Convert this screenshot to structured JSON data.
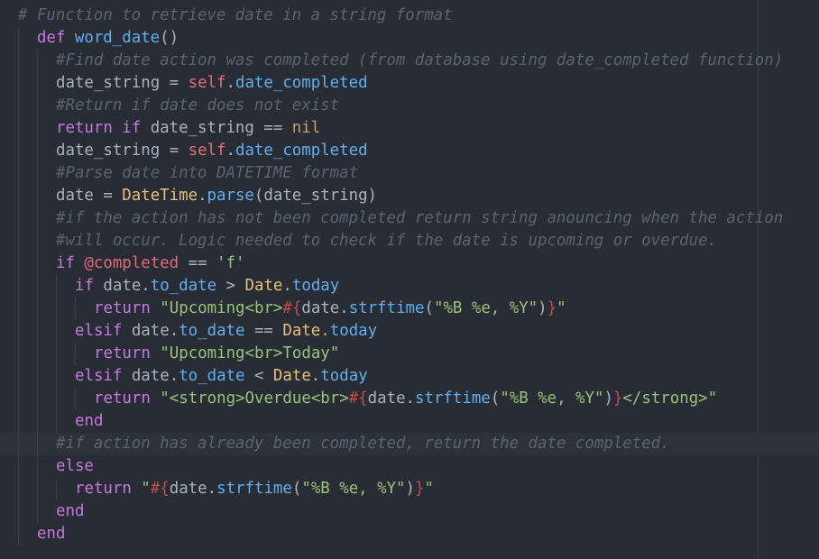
{
  "editor": {
    "theme": {
      "background": "#282c34",
      "cursor_line": "#2c313a",
      "comment": "#5c6370",
      "keyword": "#c678dd",
      "function": "#61afef",
      "self": "#e06c75",
      "constant": "#e5c07b",
      "nil": "#d19a66",
      "string": "#98c379",
      "interpolation": "#be5046",
      "text": "#abb2bf"
    },
    "lines": [
      {
        "indent": 0,
        "tokens": [
          {
            "t": "comment",
            "v": "# Function to retrieve date in a string format"
          }
        ]
      },
      {
        "indent": 1,
        "tokens": [
          {
            "t": "keyword",
            "v": "def "
          },
          {
            "t": "func",
            "v": "word_date"
          },
          {
            "t": "plain",
            "v": "()"
          }
        ]
      },
      {
        "indent": 2,
        "tokens": [
          {
            "t": "comment",
            "v": "#Find date action was completed (from database using date_completed function)"
          }
        ]
      },
      {
        "indent": 2,
        "tokens": [
          {
            "t": "plain",
            "v": "date_string = "
          },
          {
            "t": "self",
            "v": "self"
          },
          {
            "t": "plain",
            "v": "."
          },
          {
            "t": "func",
            "v": "date_completed"
          }
        ]
      },
      {
        "indent": 2,
        "tokens": [
          {
            "t": "comment",
            "v": "#Return if date does not exist"
          }
        ]
      },
      {
        "indent": 2,
        "tokens": [
          {
            "t": "keyword",
            "v": "return if "
          },
          {
            "t": "plain",
            "v": "date_string == "
          },
          {
            "t": "nil",
            "v": "nil"
          }
        ]
      },
      {
        "indent": 2,
        "tokens": [
          {
            "t": "plain",
            "v": "date_string = "
          },
          {
            "t": "self",
            "v": "self"
          },
          {
            "t": "plain",
            "v": "."
          },
          {
            "t": "func",
            "v": "date_completed"
          }
        ]
      },
      {
        "indent": 2,
        "tokens": [
          {
            "t": "comment",
            "v": "#Parse date into DATETIME format"
          }
        ]
      },
      {
        "indent": 2,
        "tokens": [
          {
            "t": "plain",
            "v": "date = "
          },
          {
            "t": "const",
            "v": "DateTime"
          },
          {
            "t": "plain",
            "v": "."
          },
          {
            "t": "func",
            "v": "parse"
          },
          {
            "t": "plain",
            "v": "(date_string)"
          }
        ]
      },
      {
        "indent": 2,
        "tokens": [
          {
            "t": "comment",
            "v": "#if the action has not been completed return string anouncing when the action"
          }
        ]
      },
      {
        "indent": 2,
        "tokens": [
          {
            "t": "comment",
            "v": "#will occur. Logic needed to check if the date is upcoming or overdue."
          }
        ]
      },
      {
        "indent": 2,
        "tokens": [
          {
            "t": "keyword",
            "v": "if "
          },
          {
            "t": "ivar",
            "v": "@completed"
          },
          {
            "t": "plain",
            "v": " == "
          },
          {
            "t": "string",
            "v": "'f'"
          }
        ]
      },
      {
        "indent": 3,
        "tokens": [
          {
            "t": "keyword",
            "v": "if "
          },
          {
            "t": "plain",
            "v": "date."
          },
          {
            "t": "func",
            "v": "to_date"
          },
          {
            "t": "plain",
            "v": " > "
          },
          {
            "t": "const",
            "v": "Date"
          },
          {
            "t": "plain",
            "v": "."
          },
          {
            "t": "func",
            "v": "today"
          }
        ]
      },
      {
        "indent": 4,
        "tokens": [
          {
            "t": "keyword",
            "v": "return "
          },
          {
            "t": "string",
            "v": "\"Upcoming<br>"
          },
          {
            "t": "interp",
            "v": "#{"
          },
          {
            "t": "plain",
            "v": "date."
          },
          {
            "t": "func",
            "v": "strftime"
          },
          {
            "t": "plain",
            "v": "("
          },
          {
            "t": "string",
            "v": "\"%B %e, %Y\""
          },
          {
            "t": "plain",
            "v": ")"
          },
          {
            "t": "interp",
            "v": "}"
          },
          {
            "t": "string",
            "v": "\""
          }
        ]
      },
      {
        "indent": 3,
        "tokens": [
          {
            "t": "keyword",
            "v": "elsif "
          },
          {
            "t": "plain",
            "v": "date."
          },
          {
            "t": "func",
            "v": "to_date"
          },
          {
            "t": "plain",
            "v": " == "
          },
          {
            "t": "const",
            "v": "Date"
          },
          {
            "t": "plain",
            "v": "."
          },
          {
            "t": "func",
            "v": "today"
          }
        ]
      },
      {
        "indent": 4,
        "tokens": [
          {
            "t": "keyword",
            "v": "return "
          },
          {
            "t": "string",
            "v": "\"Upcoming<br>Today\""
          }
        ]
      },
      {
        "indent": 3,
        "tokens": [
          {
            "t": "keyword",
            "v": "elsif "
          },
          {
            "t": "plain",
            "v": "date."
          },
          {
            "t": "func",
            "v": "to_date"
          },
          {
            "t": "plain",
            "v": " < "
          },
          {
            "t": "const",
            "v": "Date"
          },
          {
            "t": "plain",
            "v": "."
          },
          {
            "t": "func",
            "v": "today"
          }
        ]
      },
      {
        "indent": 4,
        "tokens": [
          {
            "t": "keyword",
            "v": "return "
          },
          {
            "t": "string",
            "v": "\"<strong>Overdue<br>"
          },
          {
            "t": "interp",
            "v": "#{"
          },
          {
            "t": "plain",
            "v": "date."
          },
          {
            "t": "func",
            "v": "strftime"
          },
          {
            "t": "plain",
            "v": "("
          },
          {
            "t": "string",
            "v": "\"%B %e, %Y\""
          },
          {
            "t": "plain",
            "v": ")"
          },
          {
            "t": "interp",
            "v": "}"
          },
          {
            "t": "string",
            "v": "</strong>\""
          }
        ]
      },
      {
        "indent": 3,
        "tokens": [
          {
            "t": "keyword",
            "v": "end"
          }
        ]
      },
      {
        "indent": 2,
        "cursor": true,
        "tokens": [
          {
            "t": "comment",
            "v": "#if action has already been completed, return the date completed."
          }
        ]
      },
      {
        "indent": 2,
        "tokens": [
          {
            "t": "keyword",
            "v": "else"
          }
        ]
      },
      {
        "indent": 3,
        "tokens": [
          {
            "t": "keyword",
            "v": "return "
          },
          {
            "t": "string",
            "v": "\""
          },
          {
            "t": "interp",
            "v": "#{"
          },
          {
            "t": "plain",
            "v": "date."
          },
          {
            "t": "func",
            "v": "strftime"
          },
          {
            "t": "plain",
            "v": "("
          },
          {
            "t": "string",
            "v": "\"%B %e, %Y\""
          },
          {
            "t": "plain",
            "v": ")"
          },
          {
            "t": "interp",
            "v": "}"
          },
          {
            "t": "string",
            "v": "\""
          }
        ]
      },
      {
        "indent": 2,
        "tokens": [
          {
            "t": "keyword",
            "v": "end"
          }
        ]
      },
      {
        "indent": 1,
        "tokens": [
          {
            "t": "keyword",
            "v": "end"
          }
        ]
      }
    ]
  }
}
